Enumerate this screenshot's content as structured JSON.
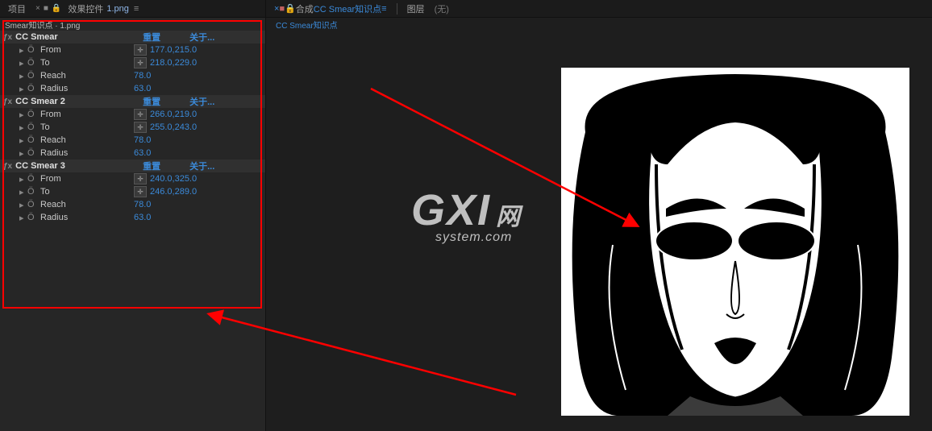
{
  "left_panel": {
    "project_label": "项目",
    "tab_prefix": "效果控件",
    "tab_file": "1.png",
    "hamburger": "≡",
    "sub_header": "Smear知识点 · 1.png"
  },
  "right_panel": {
    "tab_prefix": "合成",
    "comp_name": "CC Smear知识点",
    "hamburger": "≡",
    "layer_label": "图层",
    "layer_none": "(无)",
    "comp_sub": "CC Smear知识点"
  },
  "effects": [
    {
      "name": "CC Smear",
      "reset": "重置",
      "about": "关于...",
      "props": [
        {
          "name": "From",
          "type": "point",
          "value": "177.0,215.0"
        },
        {
          "name": "To",
          "type": "point",
          "value": "218.0,229.0"
        },
        {
          "name": "Reach",
          "type": "num",
          "value": "78.0"
        },
        {
          "name": "Radius",
          "type": "num",
          "value": "63.0"
        }
      ]
    },
    {
      "name": "CC Smear 2",
      "reset": "重置",
      "about": "关于...",
      "props": [
        {
          "name": "From",
          "type": "point",
          "value": "266.0,219.0"
        },
        {
          "name": "To",
          "type": "point",
          "value": "255.0,243.0"
        },
        {
          "name": "Reach",
          "type": "num",
          "value": "78.0"
        },
        {
          "name": "Radius",
          "type": "num",
          "value": "63.0"
        }
      ]
    },
    {
      "name": "CC Smear 3",
      "reset": "重置",
      "about": "关于...",
      "props": [
        {
          "name": "From",
          "type": "point",
          "value": "240.0,325.0"
        },
        {
          "name": "To",
          "type": "point",
          "value": "246.0,289.0"
        },
        {
          "name": "Reach",
          "type": "num",
          "value": "78.0"
        },
        {
          "name": "Radius",
          "type": "num",
          "value": "63.0"
        }
      ]
    }
  ],
  "watermark": {
    "g": "G",
    "xi": "XI",
    "net": "网",
    "sub": "system.com"
  }
}
